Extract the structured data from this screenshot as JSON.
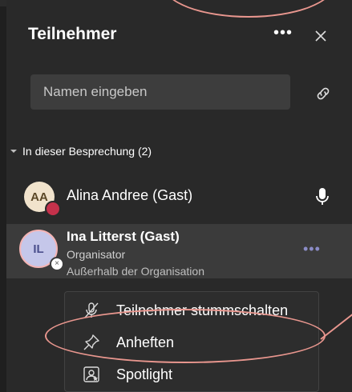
{
  "panel": {
    "title": "Teilnehmer",
    "more_label": "•••",
    "search": {
      "placeholder": "Namen eingeben"
    }
  },
  "section": {
    "label": "In dieser Besprechung (2)"
  },
  "participants": [
    {
      "initials": "AA",
      "name": "Alina Andree (Gast)"
    },
    {
      "initials": "IL",
      "name": "Ina Litterst (Gast)",
      "role": "Organisator",
      "subtitle": "Außerhalb der Organisation",
      "more_label": "•••"
    }
  ],
  "menu": {
    "items": [
      {
        "label": "Teilnehmer stummschalten",
        "icon": "mic-off-icon"
      },
      {
        "label": "Anheften",
        "icon": "pin-icon"
      },
      {
        "label": "Spotlight",
        "icon": "spotlight-icon"
      }
    ]
  },
  "colors": {
    "panel_background": "#292929",
    "selected_row": "#3b3b3b",
    "accent": "#8b8cc7",
    "presence_busy": "#c4314b",
    "annotation": "#e8968e"
  }
}
